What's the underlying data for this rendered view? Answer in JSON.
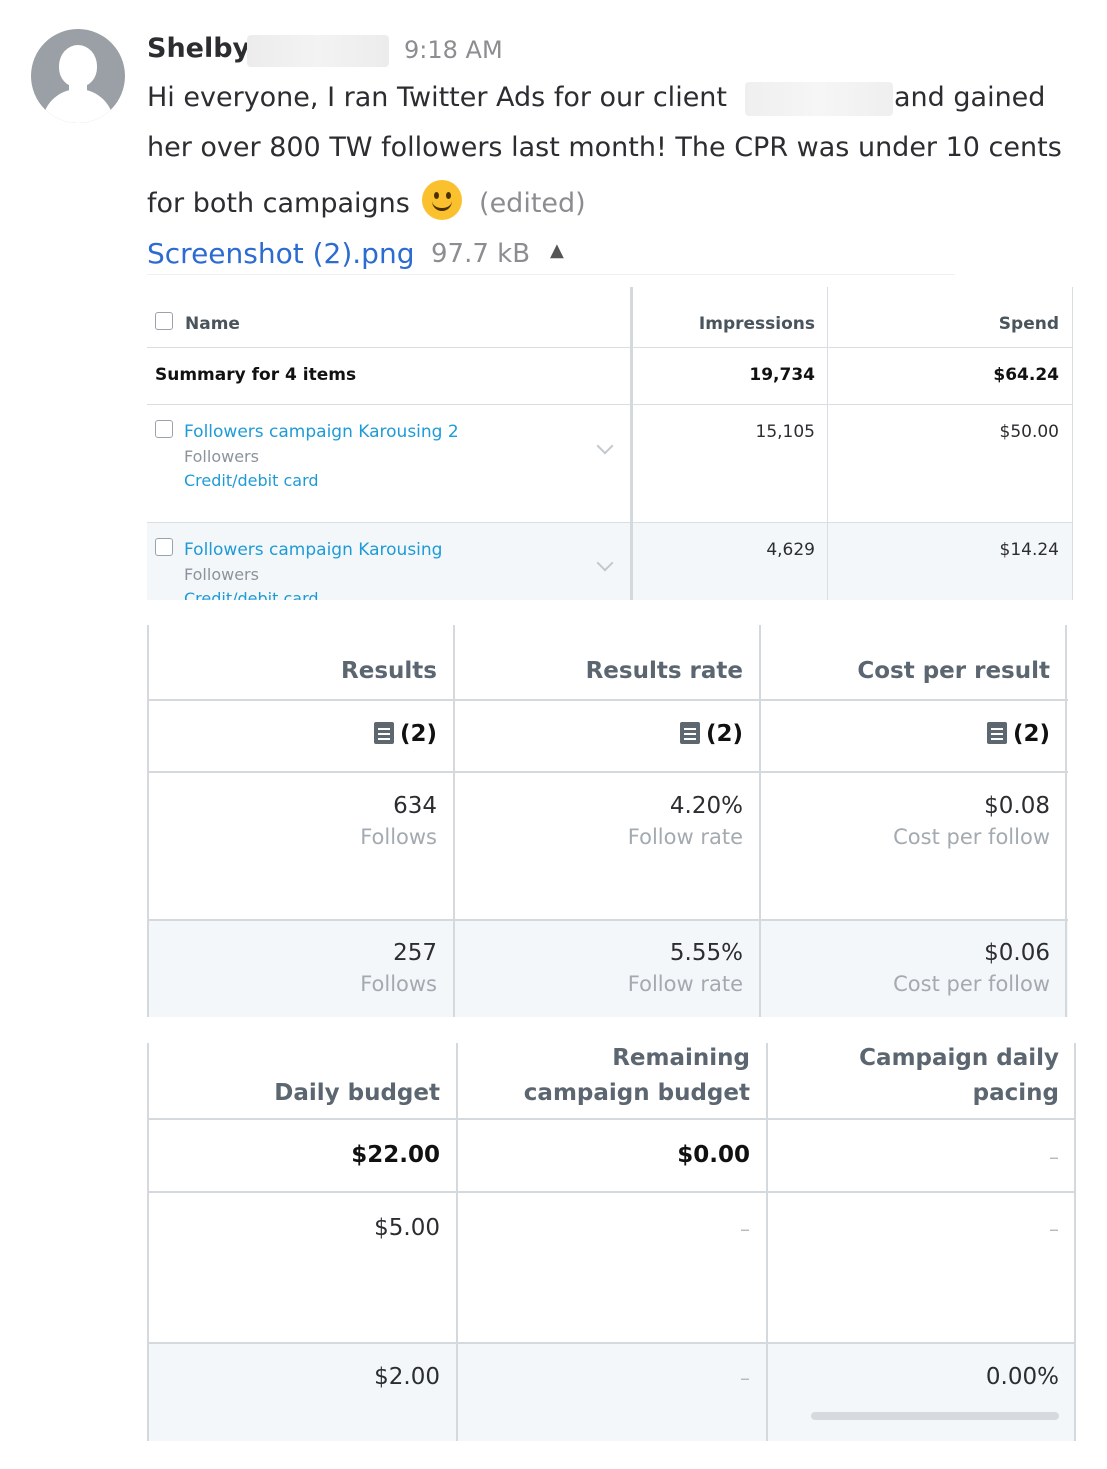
{
  "message": {
    "sender": "Shelby",
    "time": "9:18 AM",
    "line1_before": "Hi everyone, I ran Twitter Ads for our client",
    "line1_after": "and gained",
    "line2": "her over 800 TW followers last month! The CPR was under 10 cents",
    "line3": "for both campaigns",
    "edited": "(edited)",
    "attachment": {
      "name": "Screenshot (2).png",
      "size": "97.7 kB",
      "toggle_icon": "caret-up-icon"
    }
  },
  "table1": {
    "headers": {
      "name": "Name",
      "impressions": "Impressions",
      "spend": "Spend"
    },
    "summary": {
      "label": "Summary for 4 items",
      "impressions": "19,734",
      "spend": "$64.24"
    },
    "rows": [
      {
        "name": "Followers campaign Karousing 2",
        "objective": "Followers",
        "payment": "Credit/debit card",
        "impressions": "15,105",
        "spend": "$50.00"
      },
      {
        "name": "Followers campaign Karousing",
        "objective": "Followers",
        "payment": "Credit/debit card",
        "impressions": "4,629",
        "spend": "$14.24"
      }
    ]
  },
  "table2": {
    "headers": {
      "results": "Results",
      "results_rate": "Results rate",
      "cost_per_result": "Cost per result"
    },
    "summary": {
      "results": "(2)",
      "results_rate": "(2)",
      "cost_per_result": "(2)"
    },
    "rows": [
      {
        "results": "634",
        "results_label": "Follows",
        "rate": "4.20%",
        "rate_label": "Follow rate",
        "cost": "$0.08",
        "cost_label": "Cost per follow"
      },
      {
        "results": "257",
        "results_label": "Follows",
        "rate": "5.55%",
        "rate_label": "Follow rate",
        "cost": "$0.06",
        "cost_label": "Cost per follow"
      }
    ]
  },
  "table3": {
    "headers": {
      "daily_budget": "Daily budget",
      "remaining_1": "Remaining",
      "remaining_2": "campaign budget",
      "pacing_1": "Campaign daily",
      "pacing_2": "pacing"
    },
    "summary": {
      "daily_budget": "$22.00",
      "remaining": "$0.00",
      "pacing": "–"
    },
    "rows": [
      {
        "daily_budget": "$5.00",
        "remaining": "–",
        "pacing": "–"
      },
      {
        "daily_budget": "$2.00",
        "remaining": "–",
        "pacing": "0.00%",
        "pacing_fraction": 0.0
      }
    ]
  }
}
